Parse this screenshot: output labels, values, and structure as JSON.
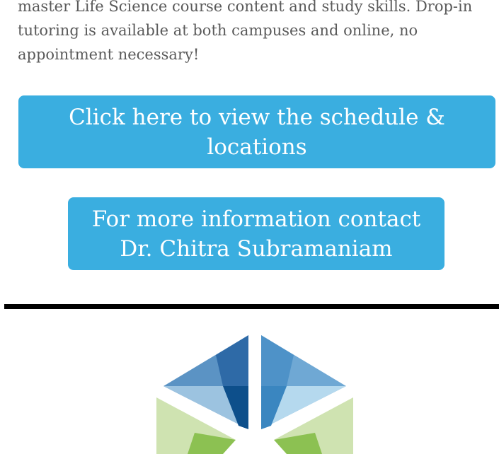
{
  "intro": {
    "text": "master Life Science course content and study skills. Drop-in tutoring is available at both campuses and online, no appointment necessary!"
  },
  "buttons": {
    "schedule": {
      "line1": "Click here to view the schedule &",
      "line2": "locations"
    },
    "contact": {
      "line1": "For more information contact",
      "line2": "Dr. Chitra Subramaniam"
    }
  },
  "colors": {
    "button_bg": "#3aaee0",
    "button_text": "#ffffff",
    "body_text": "#5a5a5a",
    "divider": "#000000"
  },
  "logo": {
    "icon": "hexagon-prism-logo-icon"
  }
}
